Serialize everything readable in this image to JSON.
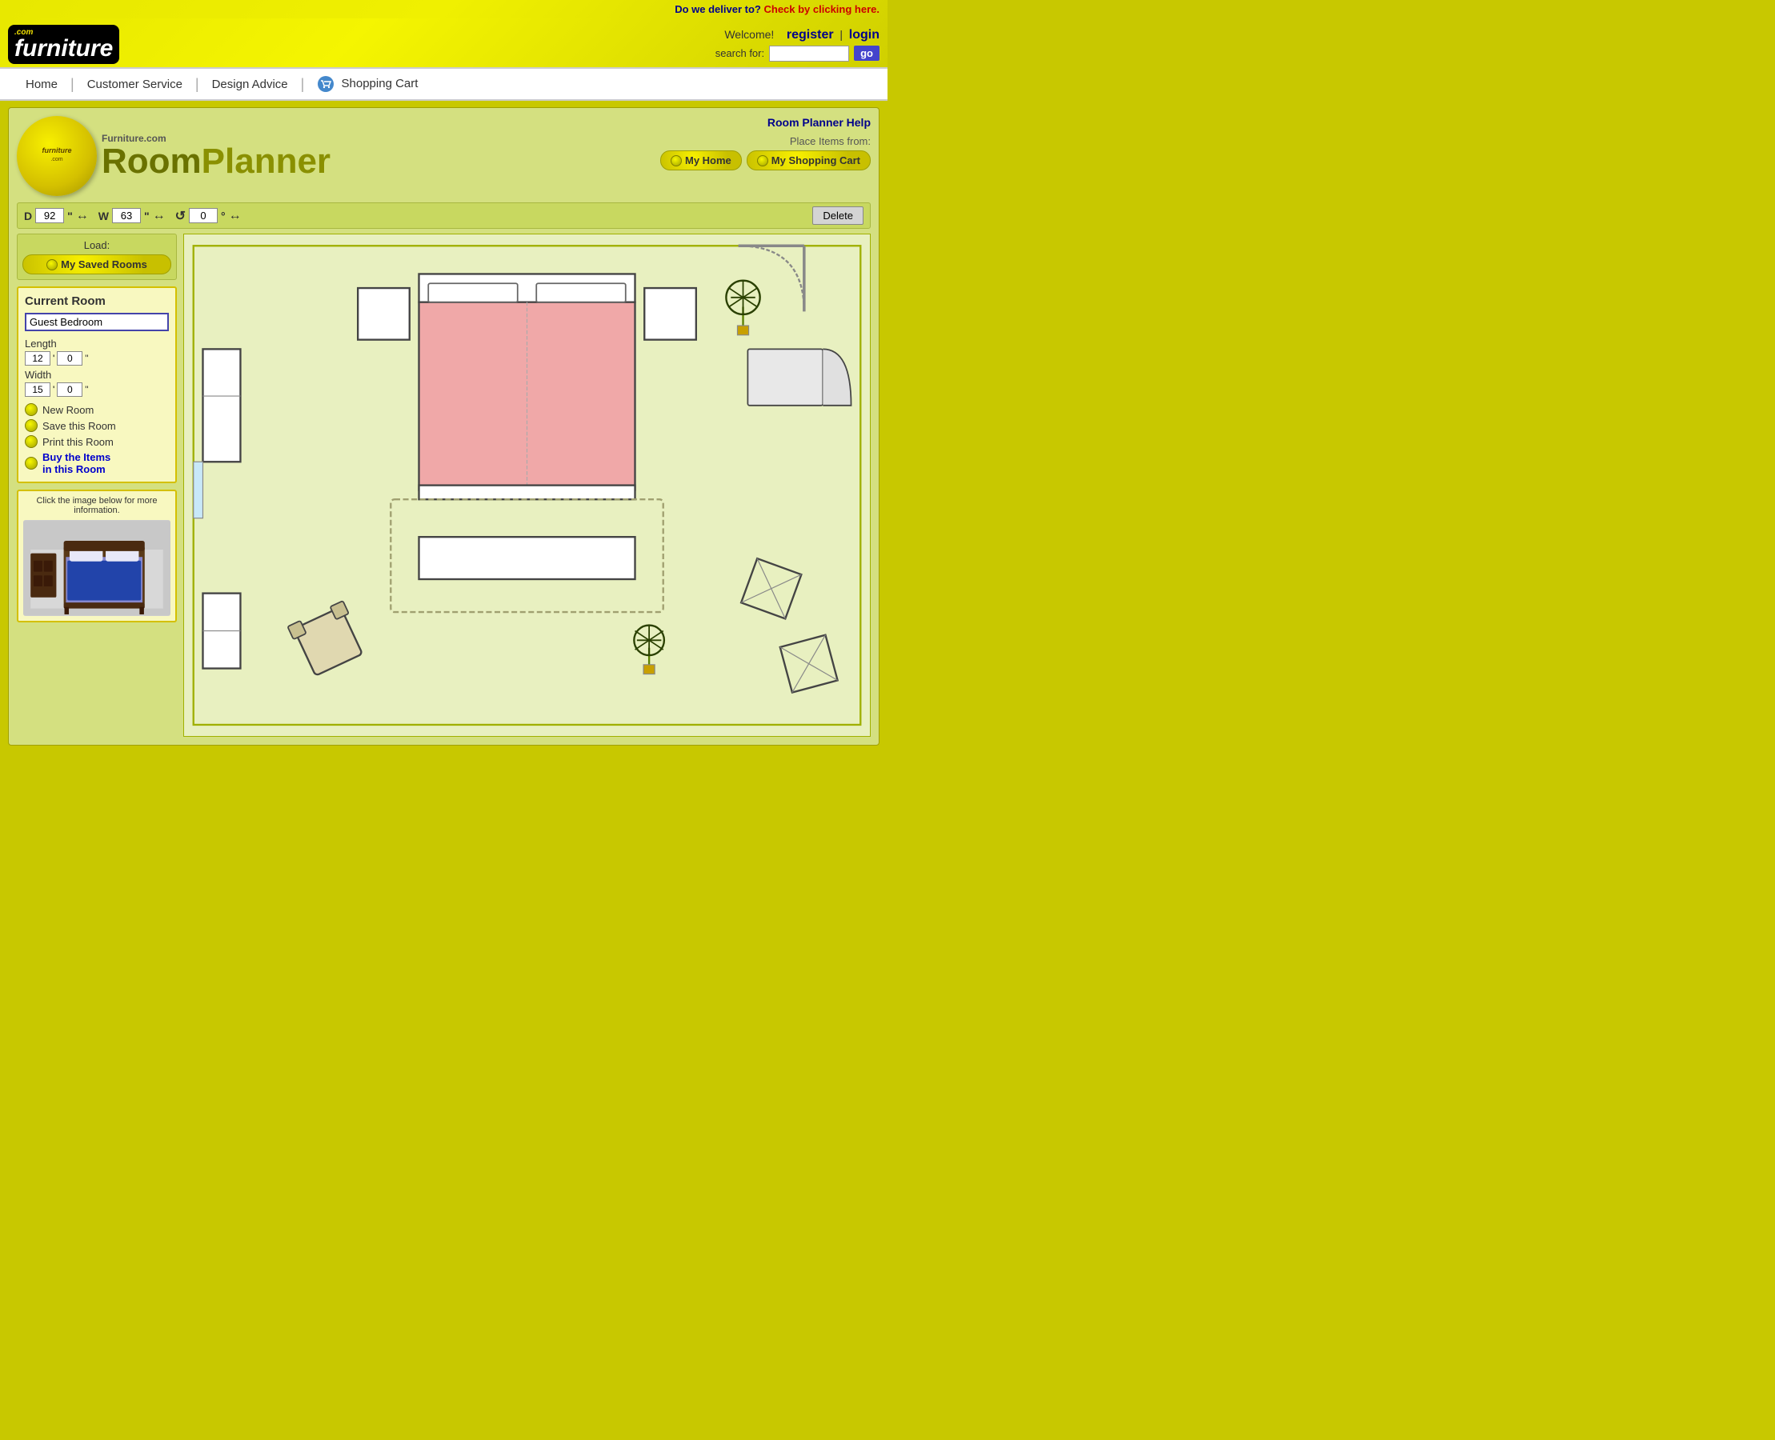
{
  "delivery": {
    "question": "Do we deliver to?",
    "link_text": "Check by clicking here."
  },
  "header": {
    "logo_com": ".com",
    "logo_furniture": "furniture",
    "welcome_text": "Welcome!",
    "register_label": "register",
    "separator": "|",
    "login_label": "login",
    "search_label": "search for:",
    "search_placeholder": "",
    "go_label": "go"
  },
  "nav": {
    "home_label": "Home",
    "customer_service_label": "Customer Service",
    "design_advice_label": "Design Advice",
    "shopping_cart_label": "Shopping Cart"
  },
  "planner": {
    "help_link": "Room Planner Help",
    "place_items_label": "Place Items from:",
    "my_home_btn": "My Home",
    "my_shopping_cart_btn": "My Shopping Cart",
    "logo_furniture_com": "Furniture.com",
    "logo_room": "Room",
    "logo_planner": "Planner",
    "depth_label": "D",
    "depth_value": "92",
    "depth_unit": "\"",
    "width_label": "W",
    "width_value": "63",
    "width_unit": "\"",
    "rotation_value": "0",
    "rotation_unit": "°",
    "delete_label": "Delete",
    "load_label": "Load:",
    "my_saved_rooms_btn": "My Saved Rooms",
    "current_room_title": "Current Room",
    "room_name": "Guest Bedroom",
    "length_label": "Length",
    "length_ft": "12",
    "length_in": "0",
    "width_dim_label": "Width",
    "width_ft": "15",
    "width_in": "0",
    "new_room_label": "New Room",
    "save_room_label": "Save this Room",
    "print_room_label": "Print this Room",
    "buy_items_label": "Buy the Items",
    "buy_items_label2": "in this Room",
    "info_text": "Click the image below for more information."
  }
}
